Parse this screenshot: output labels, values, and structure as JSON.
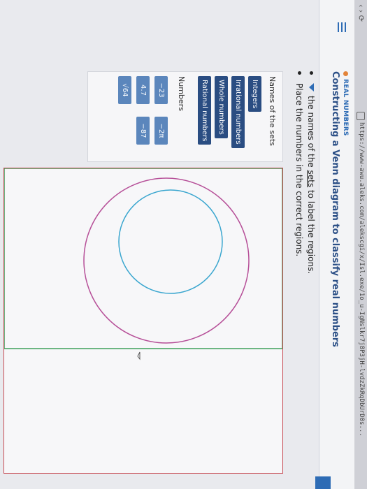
{
  "browser": {
    "url": "https://www-awu.aleks.com/alekscgi/x/Isl.exe/1o_u-IgNslkr7j8P3jH-lvdzZkRqDbUrD0s..."
  },
  "header": {
    "topic": "REAL NUMBERS",
    "title": "Constructing a Venn diagram to classify real numbers"
  },
  "instructions": {
    "line1_prefix": "the names of the ",
    "line1_link": "sets",
    "line1_suffix": " to label the regions.",
    "line2": "Place the numbers in the correct regions."
  },
  "panel": {
    "sets_label": "Names of the sets",
    "sets": [
      "Integers",
      "Irrational numbers",
      "Whole numbers",
      "Rational numbers"
    ],
    "numbers_label": "Numbers",
    "numbers": [
      "−23",
      "−2π",
      "4.7",
      "−87",
      "√64"
    ]
  },
  "colors": {
    "accent": "#2e6cb5",
    "chip": "#2a4d82",
    "outer_rect": "#c74d55",
    "inner_rect": "#3ea15a",
    "big_circle": "#b64f98",
    "small_circle": "#3aa6cf"
  }
}
